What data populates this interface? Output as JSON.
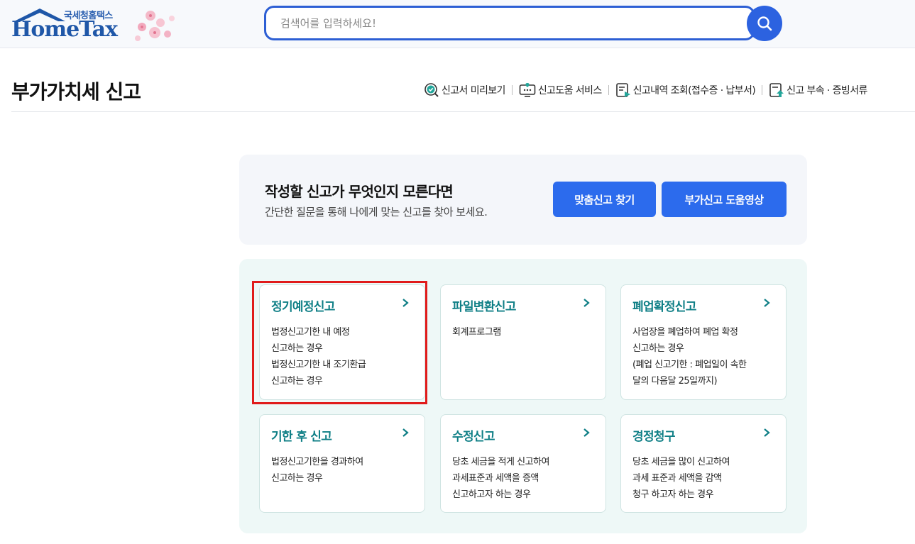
{
  "header": {
    "logo_sub": "국세청홈택스",
    "logo_main": "HomeTax",
    "search_placeholder": "검색어를 입력하세요!"
  },
  "page": {
    "title": "부가가치세 신고",
    "quick_links": [
      {
        "label": "신고서 미리보기",
        "icon": "preview-check-icon"
      },
      {
        "label": "신고도움 서비스",
        "icon": "monitor-help-icon"
      },
      {
        "label": "신고내역 조회(접수증 · 납부서)",
        "icon": "document-list-icon"
      },
      {
        "label": "신고 부속 · 증빙서류",
        "icon": "document-upload-icon"
      }
    ]
  },
  "banner": {
    "title": "작성할 신고가 무엇인지 모른다면",
    "desc": "간단한 질문을 통해 나에게 맞는 신고를 찾아 보세요.",
    "btn_find": "맞춤신고 찾기",
    "btn_video": "부가신고 도움영상"
  },
  "cards": [
    {
      "title": "정기예정신고",
      "desc": "법정신고기한 내 예정\n신고하는 경우\n법정신고기한 내 조기환급\n신고하는 경우"
    },
    {
      "title": "파일변환신고",
      "desc": "회계프로그램"
    },
    {
      "title": "폐업확정신고",
      "desc": "사업장을 폐업하여 폐업 확정\n신고하는 경우\n(폐업 신고기한 : 폐업일이 속한\n달의 다음달 25일까지)"
    },
    {
      "title": "기한 후 신고",
      "desc": "법정신고기한을 경과하여\n신고하는 경우"
    },
    {
      "title": "수정신고",
      "desc": "당초 세금을 적게 신고하여\n과세표준과 세액을 증액\n신고하고자 하는 경우"
    },
    {
      "title": "경정청구",
      "desc": "당초 세금을 많이 신고하여\n과세 표준과 세액을 감액\n청구 하고자 하는 경우"
    }
  ],
  "colors": {
    "accent_blue": "#2c6bed",
    "card_title_teal": "#0f7f86",
    "highlight_red": "#e01b1b"
  }
}
